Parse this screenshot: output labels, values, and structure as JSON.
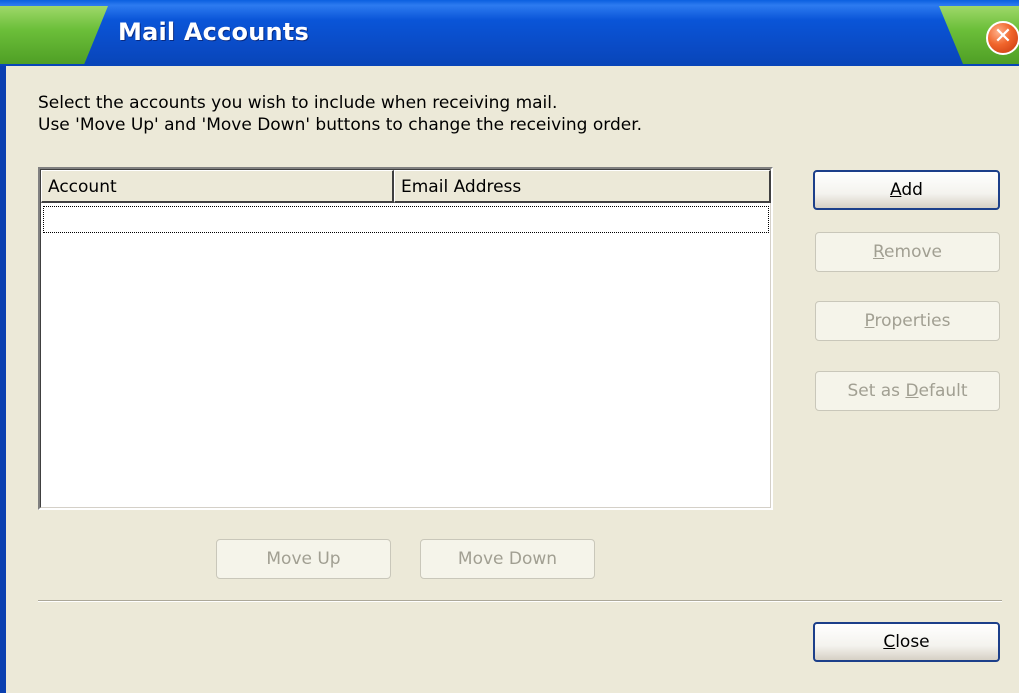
{
  "window": {
    "title": "Mail Accounts",
    "close_glyph": "✕"
  },
  "description": {
    "line1": "Select the accounts you wish to include when receiving mail.",
    "line2": "Use 'Move Up' and 'Move Down' buttons to change the receiving order."
  },
  "accounts_list": {
    "columns": [
      "Account",
      "Email Address"
    ],
    "rows": []
  },
  "buttons": {
    "add": {
      "pre": "",
      "key": "A",
      "post": "dd",
      "enabled": true
    },
    "remove": {
      "pre": "",
      "key": "R",
      "post": "emove",
      "enabled": false
    },
    "properties": {
      "pre": "",
      "key": "P",
      "post": "roperties",
      "enabled": false
    },
    "set_default": {
      "pre": "Set as ",
      "key": "D",
      "post": "efault",
      "enabled": false
    },
    "move_up": {
      "label": "Move Up",
      "enabled": false
    },
    "move_down": {
      "label": "Move Down",
      "enabled": false
    },
    "close": {
      "pre": "",
      "key": "C",
      "post": "lose",
      "enabled": true
    }
  },
  "colors": {
    "titlebar": "#0a55d8",
    "title_tab_green": "#6cbf3a",
    "dialog_bg": "#ece9d8",
    "close_button": "#f0652b"
  }
}
